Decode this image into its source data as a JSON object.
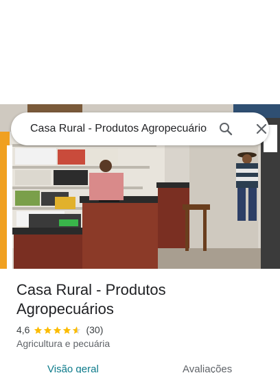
{
  "search": {
    "query": "Casa Rural - Produtos Agropecuários"
  },
  "icons": {
    "search": "search-icon",
    "close": "close-icon",
    "star": "star-icon"
  },
  "place": {
    "name": "Casa Rural - Produtos Agropecuários",
    "rating": "4,6",
    "rating_value": 4.6,
    "review_count": "(30)",
    "category": "Agricultura e pecuária"
  },
  "tabs": [
    {
      "label": "Visão geral"
    },
    {
      "label": "Avaliações"
    }
  ],
  "colors": {
    "star": "#fbbc04",
    "active_tab": "#0b7a8a",
    "text": "#202124",
    "secondary_text": "#5f6368"
  }
}
